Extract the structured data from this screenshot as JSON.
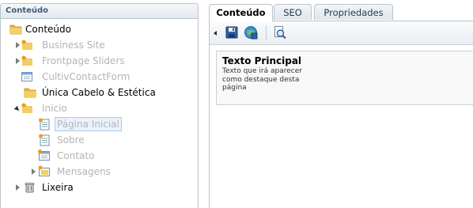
{
  "tree": {
    "header": "Conteúdo",
    "items": [
      {
        "label": "Conteúdo"
      },
      {
        "label": "Business Site"
      },
      {
        "label": "Frontpage Sliders"
      },
      {
        "label": "CultivContactForm"
      },
      {
        "label": "Única Cabelo & Estética"
      },
      {
        "label": "Inicio"
      },
      {
        "label": "Página Inicial"
      },
      {
        "label": "Sobre"
      },
      {
        "label": "Contato"
      },
      {
        "label": "Mensagens"
      },
      {
        "label": "Lixeira"
      }
    ]
  },
  "tabs": [
    {
      "label": "Conteúdo"
    },
    {
      "label": "SEO"
    },
    {
      "label": "Propriedades"
    }
  ],
  "toolbar": {
    "save_icon": "save-icon",
    "publish_icon": "save-publish-icon",
    "preview_icon": "preview-icon"
  },
  "field": {
    "title": "Texto Principal",
    "description": "Texto que irá aparecer como destaque desta página"
  },
  "colors": {
    "folder": "#e8b43a",
    "faded_text": "#b4b4b4",
    "panel_border": "#b9c3cd"
  }
}
